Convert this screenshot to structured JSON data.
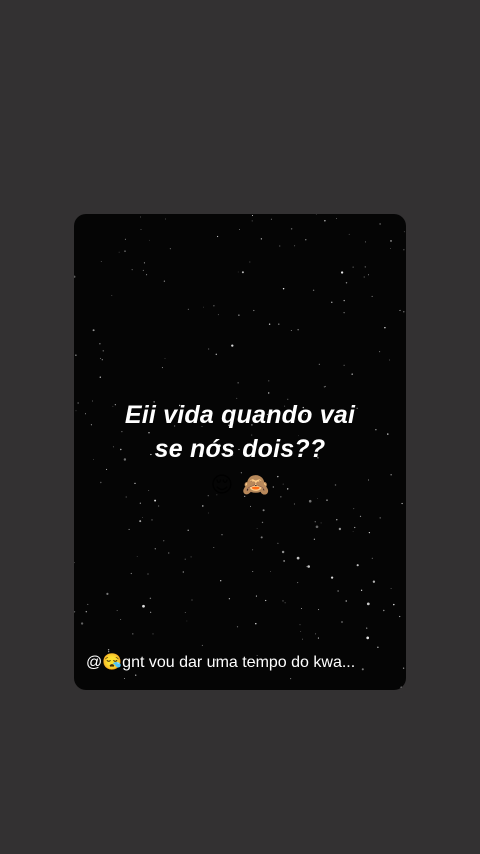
{
  "story": {
    "caption_line1": "Eii vida quando vai",
    "caption_line2": "se nós dois??",
    "emoji_relieved": "😌",
    "emoji_monkey": "🙈",
    "mention_text": "@😪gnt vou dar uma tempo do kwa..."
  },
  "colors": {
    "page_background": "#333132",
    "card_background": "#050505",
    "text": "#ffffff"
  },
  "icons": [
    "relieved-face-emoji",
    "see-no-evil-monkey-emoji",
    "sleepy-face-emoji"
  ]
}
